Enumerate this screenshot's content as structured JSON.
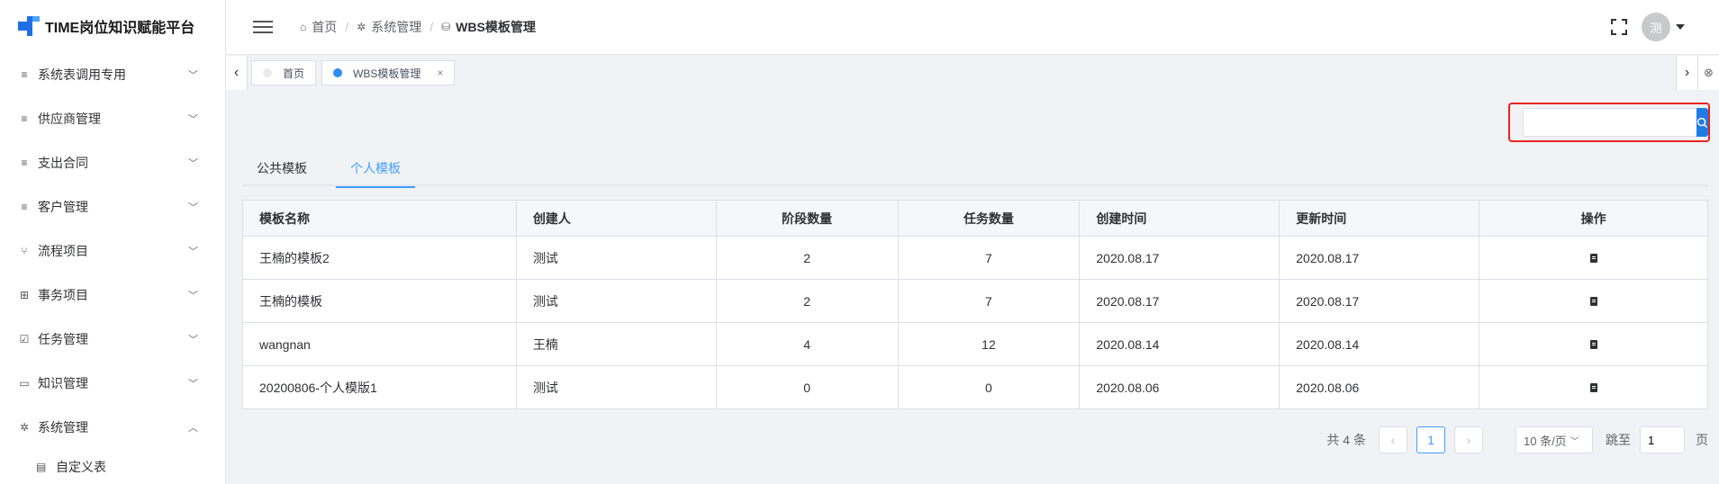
{
  "app": {
    "title": "TIME岗位知识赋能平台"
  },
  "sidebar": {
    "items": [
      {
        "label": "系统表调用专用",
        "icon": "list-icon",
        "glyph": "≡",
        "chevron": "﹀"
      },
      {
        "label": "供应商管理",
        "icon": "list-icon",
        "glyph": "≡",
        "chevron": "﹀"
      },
      {
        "label": "支出合同",
        "icon": "list-icon",
        "glyph": "≡",
        "chevron": "﹀"
      },
      {
        "label": "客户管理",
        "icon": "list-icon",
        "glyph": "≡",
        "chevron": "﹀"
      },
      {
        "label": "流程项目",
        "icon": "branch-icon",
        "glyph": "⑂",
        "chevron": "﹀"
      },
      {
        "label": "事务项目",
        "icon": "grid-icon",
        "glyph": "⊞",
        "chevron": "﹀"
      },
      {
        "label": "任务管理",
        "icon": "checkbox-icon",
        "glyph": "☑",
        "chevron": "﹀"
      },
      {
        "label": "知识管理",
        "icon": "book-icon",
        "glyph": "▭",
        "chevron": "﹀"
      },
      {
        "label": "系统管理",
        "icon": "gear-icon",
        "glyph": "✲",
        "chevron": "︿"
      }
    ],
    "sub_items": [
      {
        "label": "自定义表",
        "icon": "document-icon",
        "glyph": "▤"
      }
    ]
  },
  "breadcrumb": {
    "items": [
      "首页",
      "系统管理",
      "WBS模板管理"
    ],
    "separator": "/"
  },
  "header": {
    "avatar_text": "测"
  },
  "tags": [
    {
      "label": "首页",
      "active": false
    },
    {
      "label": "WBS模板管理",
      "active": true,
      "close": "×"
    }
  ],
  "search": {
    "placeholder": "",
    "value": ""
  },
  "tabs": [
    {
      "label": "公共模板",
      "active": false
    },
    {
      "label": "个人模板",
      "active": true
    }
  ],
  "table": {
    "columns": [
      "模板名称",
      "创建人",
      "阶段数量",
      "任务数量",
      "创建时间",
      "更新时间",
      "操作"
    ],
    "rows": [
      [
        "王楠的模板2",
        "测试",
        "2",
        "7",
        "2020.08.17",
        "2020.08.17"
      ],
      [
        "王楠的模板",
        "测试",
        "2",
        "7",
        "2020.08.17",
        "2020.08.17"
      ],
      [
        "wangnan",
        "王楠",
        "4",
        "12",
        "2020.08.14",
        "2020.08.14"
      ],
      [
        "20200806-个人模版1",
        "测试",
        "0",
        "0",
        "2020.08.06",
        "2020.08.06"
      ]
    ]
  },
  "pagination": {
    "total": "共 4 条",
    "current_page": "1",
    "page_size": "10 条/页",
    "jump_label": "跳至",
    "jump_value": "1",
    "page_suffix": "页"
  },
  "colors": {
    "primary": "#409eff",
    "search_button": "#1f7be6",
    "highlight_border": "#e8251c"
  }
}
